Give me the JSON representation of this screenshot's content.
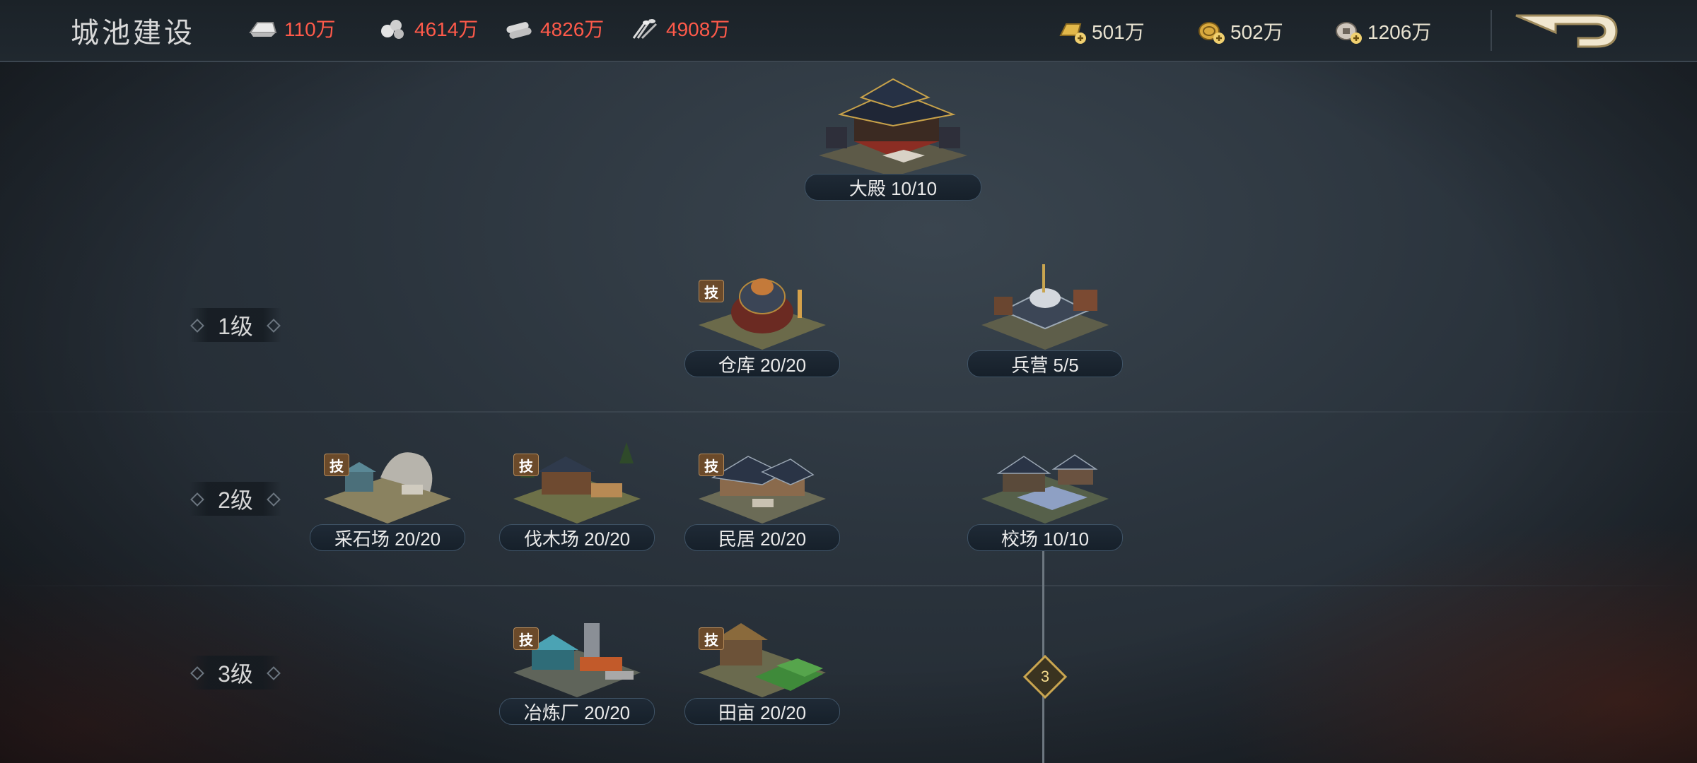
{
  "header": {
    "title": "城池建设",
    "resources": [
      {
        "icon": "silver-ingot-icon",
        "value": "110万"
      },
      {
        "icon": "stone-icon",
        "value": "4614万"
      },
      {
        "icon": "wood-icon",
        "value": "4826万"
      },
      {
        "icon": "grain-icon",
        "value": "4908万"
      }
    ],
    "currencies": [
      {
        "icon": "gold-bar-plus-icon",
        "value": "501万"
      },
      {
        "icon": "gold-coin-plus-icon",
        "value": "502万"
      },
      {
        "icon": "copper-coin-plus-icon",
        "value": "1206万"
      }
    ]
  },
  "tiers": [
    {
      "label": "1级"
    },
    {
      "label": "2级"
    },
    {
      "label": "3级"
    }
  ],
  "tech_badge_text": "技",
  "buildings": {
    "palace": {
      "name": "大殿 10/10"
    },
    "warehouse": {
      "name": "仓库 20/20",
      "tech": true
    },
    "barracks": {
      "name": "兵营 5/5"
    },
    "quarry": {
      "name": "采石场 20/20",
      "tech": true
    },
    "lumber": {
      "name": "伐木场 20/20",
      "tech": true
    },
    "housing": {
      "name": "民居 20/20",
      "tech": true
    },
    "training": {
      "name": "校场 10/10"
    },
    "smelter": {
      "name": "冶炼厂 20/20",
      "tech": true
    },
    "farm": {
      "name": "田亩 20/20",
      "tech": true
    }
  },
  "tree_node": {
    "value": "3"
  },
  "colors": {
    "resource_value": "#ff5a4a",
    "accent_gold": "#c9a550",
    "background": "#2a333c"
  }
}
